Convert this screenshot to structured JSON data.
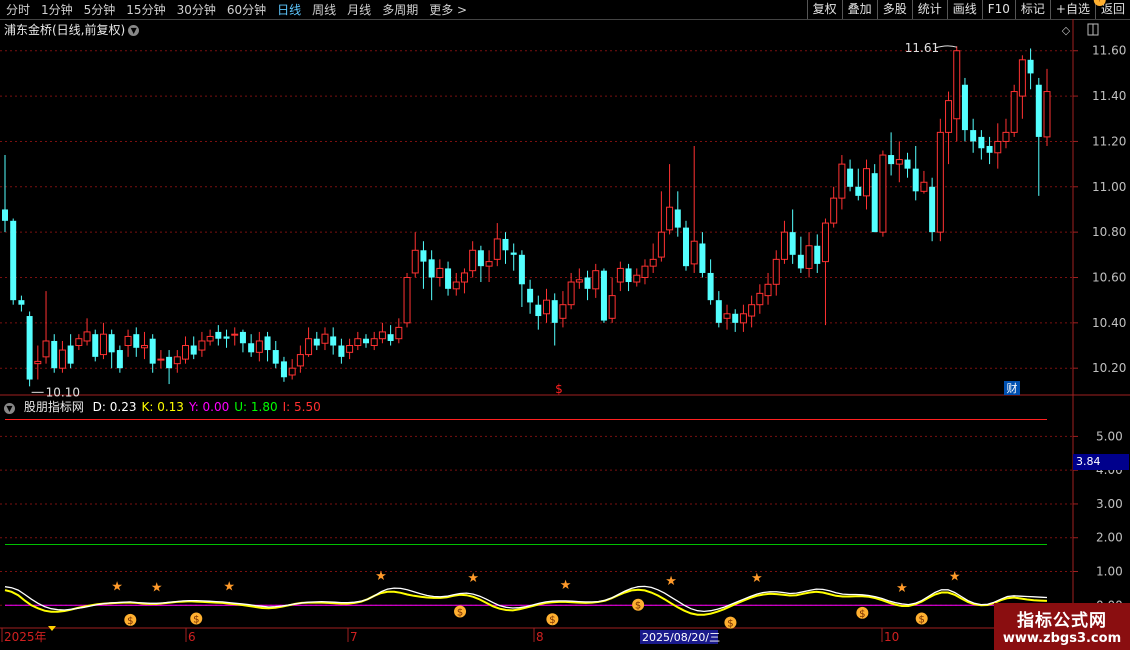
{
  "toolbar": {
    "periods": [
      "分时",
      "1分钟",
      "5分钟",
      "15分钟",
      "30分钟",
      "60分钟",
      "日线",
      "周线",
      "月线",
      "多周期",
      "更多 >"
    ],
    "active_period": "日线",
    "actions": [
      "复权",
      "叠加",
      "多股",
      "统计",
      "画线",
      "F10",
      "标记",
      "+自选",
      "返回"
    ]
  },
  "stock": {
    "title": "浦东金桥(日线,前复权)",
    "high_label": "11.61",
    "low_label": "10.10",
    "marker_s": "$",
    "marker_cai": "财"
  },
  "price_axis": [
    "11.60",
    "11.40",
    "11.20",
    "11.00",
    "10.80",
    "10.60",
    "10.40",
    "10.20"
  ],
  "indicator": {
    "name": "股朋指标网",
    "values": [
      {
        "label": "D: 0.23",
        "color": "#ffffff"
      },
      {
        "label": "K: 0.13",
        "color": "#ffff00"
      },
      {
        "label": "Y: 0.00",
        "color": "#ff00ff"
      },
      {
        "label": "U: 1.80",
        "color": "#00ff00"
      },
      {
        "label": "I: 5.50",
        "color": "#ff3030"
      }
    ],
    "axis": [
      "5.00",
      "4.00",
      "3.00",
      "2.00",
      "1.00",
      "0.00"
    ],
    "current_value": "3.84"
  },
  "time_axis": [
    "2025年",
    "6",
    "7",
    "8",
    "10"
  ],
  "cursor_date": "2025/08/20/三",
  "watermark": {
    "line1": "指标公式网",
    "line2": "www.zbgs3.com"
  },
  "colors": {
    "up": "#ff3232",
    "down": "#54ffff",
    "grid": "#7a1010"
  },
  "chart_data": {
    "type": "candlestick",
    "ylim": [
      10.1,
      11.61
    ],
    "candles": [
      [
        10.9,
        10.85,
        11.14,
        10.8
      ],
      [
        10.85,
        10.5,
        10.86,
        10.48
      ],
      [
        10.5,
        10.48,
        10.52,
        10.45
      ],
      [
        10.43,
        10.15,
        10.45,
        10.12
      ],
      [
        10.22,
        10.23,
        10.3,
        10.15
      ],
      [
        10.25,
        10.32,
        10.54,
        10.22
      ],
      [
        10.32,
        10.2,
        10.35,
        10.18
      ],
      [
        10.2,
        10.28,
        10.32,
        10.18
      ],
      [
        10.3,
        10.22,
        10.35,
        10.2
      ],
      [
        10.3,
        10.33,
        10.35,
        10.28
      ],
      [
        10.32,
        10.36,
        10.42,
        10.3
      ],
      [
        10.35,
        10.25,
        10.37,
        10.23
      ],
      [
        10.26,
        10.35,
        10.4,
        10.24
      ],
      [
        10.35,
        10.27,
        10.37,
        10.2
      ],
      [
        10.28,
        10.2,
        10.3,
        10.18
      ],
      [
        10.3,
        10.34,
        10.37,
        10.25
      ],
      [
        10.35,
        10.29,
        10.38,
        10.25
      ],
      [
        10.29,
        10.3,
        10.36,
        10.24
      ],
      [
        10.33,
        10.22,
        10.35,
        10.18
      ],
      [
        10.24,
        10.24,
        10.28,
        10.2
      ],
      [
        10.25,
        10.2,
        10.28,
        10.13
      ],
      [
        10.22,
        10.25,
        10.28,
        10.18
      ],
      [
        10.24,
        10.3,
        10.34,
        10.22
      ],
      [
        10.3,
        10.26,
        10.34,
        10.24
      ],
      [
        10.28,
        10.32,
        10.36,
        10.25
      ],
      [
        10.32,
        10.34,
        10.37,
        10.3
      ],
      [
        10.36,
        10.33,
        10.39,
        10.3
      ],
      [
        10.34,
        10.33,
        10.37,
        10.29
      ],
      [
        10.35,
        10.35,
        10.38,
        10.3
      ],
      [
        10.36,
        10.31,
        10.37,
        10.27
      ],
      [
        10.31,
        10.27,
        10.35,
        10.25
      ],
      [
        10.27,
        10.32,
        10.36,
        10.23
      ],
      [
        10.34,
        10.28,
        10.36,
        10.23
      ],
      [
        10.28,
        10.22,
        10.32,
        10.2
      ],
      [
        10.23,
        10.16,
        10.25,
        10.14
      ],
      [
        10.17,
        10.2,
        10.24,
        10.15
      ],
      [
        10.21,
        10.26,
        10.3,
        10.18
      ],
      [
        10.26,
        10.33,
        10.38,
        10.25
      ],
      [
        10.33,
        10.3,
        10.36,
        10.28
      ],
      [
        10.31,
        10.35,
        10.38,
        10.28
      ],
      [
        10.34,
        10.3,
        10.38,
        10.26
      ],
      [
        10.3,
        10.25,
        10.33,
        10.22
      ],
      [
        10.27,
        10.3,
        10.33,
        10.24
      ],
      [
        10.3,
        10.33,
        10.36,
        10.28
      ],
      [
        10.33,
        10.31,
        10.35,
        10.29
      ],
      [
        10.3,
        10.33,
        10.36,
        10.28
      ],
      [
        10.33,
        10.36,
        10.4,
        10.31
      ],
      [
        10.35,
        10.32,
        10.39,
        10.3
      ],
      [
        10.33,
        10.38,
        10.42,
        10.31
      ],
      [
        10.4,
        10.6,
        10.62,
        10.38
      ],
      [
        10.62,
        10.72,
        10.8,
        10.6
      ],
      [
        10.72,
        10.67,
        10.76,
        10.55
      ],
      [
        10.68,
        10.6,
        10.72,
        10.5
      ],
      [
        10.6,
        10.64,
        10.68,
        10.56
      ],
      [
        10.64,
        10.55,
        10.67,
        10.52
      ],
      [
        10.55,
        10.58,
        10.62,
        10.52
      ],
      [
        10.58,
        10.62,
        10.64,
        10.53
      ],
      [
        10.63,
        10.72,
        10.76,
        10.6
      ],
      [
        10.72,
        10.65,
        10.74,
        10.58
      ],
      [
        10.65,
        10.67,
        10.72,
        10.58
      ],
      [
        10.68,
        10.77,
        10.84,
        10.65
      ],
      [
        10.77,
        10.72,
        10.8,
        10.66
      ],
      [
        10.71,
        10.7,
        10.75,
        10.63
      ],
      [
        10.7,
        10.57,
        10.72,
        10.47
      ],
      [
        10.55,
        10.49,
        10.59,
        10.44
      ],
      [
        10.48,
        10.43,
        10.52,
        10.37
      ],
      [
        10.44,
        10.5,
        10.55,
        10.4
      ],
      [
        10.5,
        10.4,
        10.53,
        10.3
      ],
      [
        10.42,
        10.48,
        10.54,
        10.38
      ],
      [
        10.48,
        10.58,
        10.62,
        10.46
      ],
      [
        10.58,
        10.59,
        10.64,
        10.55
      ],
      [
        10.6,
        10.55,
        10.63,
        10.5
      ],
      [
        10.55,
        10.63,
        10.66,
        10.51
      ],
      [
        10.63,
        10.41,
        10.64,
        10.4
      ],
      [
        10.42,
        10.52,
        10.6,
        10.4
      ],
      [
        10.58,
        10.64,
        10.67,
        10.54
      ],
      [
        10.64,
        10.58,
        10.66,
        10.54
      ],
      [
        10.58,
        10.61,
        10.64,
        10.56
      ],
      [
        10.6,
        10.65,
        10.68,
        10.57
      ],
      [
        10.65,
        10.68,
        10.75,
        10.62
      ],
      [
        10.69,
        10.8,
        10.98,
        10.67
      ],
      [
        10.81,
        10.91,
        11.1,
        10.79
      ],
      [
        10.9,
        10.82,
        10.98,
        10.78
      ],
      [
        10.82,
        10.65,
        10.85,
        10.63
      ],
      [
        10.66,
        10.76,
        11.18,
        10.62
      ],
      [
        10.75,
        10.62,
        10.8,
        10.6
      ],
      [
        10.62,
        10.5,
        10.68,
        10.48
      ],
      [
        10.5,
        10.4,
        10.54,
        10.38
      ],
      [
        10.42,
        10.44,
        10.48,
        10.37
      ],
      [
        10.44,
        10.4,
        10.46,
        10.36
      ],
      [
        10.4,
        10.44,
        10.48,
        10.36
      ],
      [
        10.43,
        10.48,
        10.52,
        10.38
      ],
      [
        10.48,
        10.53,
        10.57,
        10.44
      ],
      [
        10.52,
        10.57,
        10.62,
        10.48
      ],
      [
        10.57,
        10.68,
        10.72,
        10.52
      ],
      [
        10.68,
        10.8,
        10.85,
        10.66
      ],
      [
        10.8,
        10.7,
        10.9,
        10.66
      ],
      [
        10.7,
        10.64,
        10.78,
        10.62
      ],
      [
        10.64,
        10.74,
        10.8,
        10.6
      ],
      [
        10.74,
        10.66,
        10.79,
        10.62
      ],
      [
        10.67,
        10.84,
        10.86,
        10.39
      ],
      [
        10.84,
        10.95,
        11.0,
        10.82
      ],
      [
        10.95,
        11.1,
        11.14,
        10.9
      ],
      [
        11.08,
        11.0,
        11.12,
        10.98
      ],
      [
        11.0,
        10.96,
        11.08,
        10.94
      ],
      [
        10.96,
        11.08,
        11.12,
        10.9
      ],
      [
        11.06,
        10.8,
        11.1,
        10.8
      ],
      [
        10.8,
        11.14,
        11.16,
        10.78
      ],
      [
        11.14,
        11.1,
        11.24,
        11.05
      ],
      [
        11.1,
        11.12,
        11.2,
        11.02
      ],
      [
        11.12,
        11.08,
        11.15,
        11.04
      ],
      [
        11.08,
        10.98,
        11.18,
        10.94
      ],
      [
        10.98,
        11.02,
        11.07,
        10.97
      ],
      [
        11.0,
        10.8,
        11.04,
        10.76
      ],
      [
        10.8,
        11.24,
        11.3,
        10.76
      ],
      [
        11.24,
        11.38,
        11.42,
        11.1
      ],
      [
        11.3,
        11.6,
        11.62,
        11.2
      ],
      [
        11.45,
        11.25,
        11.48,
        11.2
      ],
      [
        11.25,
        11.2,
        11.3,
        11.15
      ],
      [
        11.22,
        11.17,
        11.25,
        11.12
      ],
      [
        11.18,
        11.15,
        11.22,
        11.1
      ],
      [
        11.15,
        11.2,
        11.28,
        11.08
      ],
      [
        11.2,
        11.24,
        11.3,
        11.17
      ],
      [
        11.24,
        11.42,
        11.45,
        11.22
      ],
      [
        11.4,
        11.56,
        11.58,
        11.3
      ],
      [
        11.56,
        11.5,
        11.61,
        11.43
      ],
      [
        11.45,
        11.22,
        11.48,
        10.96
      ],
      [
        11.22,
        11.42,
        11.52,
        11.18
      ]
    ],
    "indicator_d": [
      0.55,
      0.52,
      0.45,
      0.32,
      0.18,
      0.06,
      -0.04,
      -0.1,
      -0.13,
      -0.14,
      -0.12,
      -0.09,
      -0.06,
      -0.02,
      0.02,
      0.05,
      0.07,
      0.08,
      0.09,
      0.1,
      0.08,
      0.07,
      0.06,
      0.06,
      0.07,
      0.09,
      0.11,
      0.13,
      0.14,
      0.14,
      0.13,
      0.12,
      0.11,
      0.1,
      0.08,
      0.06,
      0.04,
      0.02,
      -0.01,
      -0.03,
      -0.05,
      -0.04,
      -0.02,
      0.01,
      0.04,
      0.07,
      0.09,
      0.1,
      0.11,
      0.1,
      0.09,
      0.08,
      0.08,
      0.09,
      0.12,
      0.18,
      0.28,
      0.4,
      0.48,
      0.51,
      0.5,
      0.46,
      0.4,
      0.34,
      0.29,
      0.26,
      0.25,
      0.27,
      0.31,
      0.35,
      0.36,
      0.33,
      0.27,
      0.18,
      0.08,
      -0.01,
      -0.06,
      -0.08,
      -0.07,
      -0.04,
      0.01,
      0.06,
      0.1,
      0.12,
      0.13,
      0.13,
      0.12,
      0.11,
      0.1,
      0.1,
      0.11,
      0.15,
      0.22,
      0.32,
      0.42,
      0.5,
      0.55,
      0.56,
      0.53,
      0.46,
      0.36,
      0.24,
      0.12,
      0.0,
      -0.1,
      -0.16,
      -0.18,
      -0.16,
      -0.12,
      -0.06,
      0.02,
      0.1,
      0.18,
      0.26,
      0.33,
      0.38,
      0.4,
      0.4,
      0.38,
      0.35,
      0.36,
      0.4,
      0.44,
      0.48,
      0.47,
      0.43,
      0.37,
      0.33,
      0.32,
      0.32,
      0.31,
      0.29,
      0.25,
      0.2,
      0.13,
      0.08,
      0.04,
      0.02,
      0.06,
      0.14,
      0.26,
      0.38,
      0.46,
      0.46,
      0.38,
      0.26,
      0.14,
      0.06,
      0.02,
      0.03,
      0.09,
      0.18,
      0.26,
      0.28,
      0.27,
      0.26,
      0.25,
      0.24,
      0.23
    ],
    "indicator_k": [
      0.45,
      0.4,
      0.3,
      0.14,
      0.0,
      -0.09,
      -0.16,
      -0.19,
      -0.19,
      -0.17,
      -0.13,
      -0.08,
      -0.04,
      0.0,
      0.03,
      0.05,
      0.06,
      0.07,
      0.08,
      0.08,
      0.07,
      0.05,
      0.04,
      0.04,
      0.06,
      0.08,
      0.1,
      0.11,
      0.12,
      0.11,
      0.1,
      0.09,
      0.08,
      0.07,
      0.05,
      0.03,
      0.01,
      -0.02,
      -0.05,
      -0.08,
      -0.09,
      -0.07,
      -0.04,
      0.0,
      0.04,
      0.07,
      0.08,
      0.08,
      0.08,
      0.07,
      0.06,
      0.05,
      0.05,
      0.07,
      0.11,
      0.18,
      0.28,
      0.36,
      0.4,
      0.4,
      0.37,
      0.32,
      0.28,
      0.25,
      0.23,
      0.22,
      0.22,
      0.24,
      0.28,
      0.31,
      0.3,
      0.25,
      0.17,
      0.07,
      -0.03,
      -0.1,
      -0.14,
      -0.15,
      -0.12,
      -0.07,
      -0.02,
      0.03,
      0.07,
      0.09,
      0.1,
      0.1,
      0.09,
      0.08,
      0.07,
      0.08,
      0.1,
      0.14,
      0.21,
      0.3,
      0.38,
      0.44,
      0.46,
      0.44,
      0.38,
      0.29,
      0.18,
      0.06,
      -0.06,
      -0.16,
      -0.24,
      -0.28,
      -0.28,
      -0.25,
      -0.19,
      -0.12,
      -0.03,
      0.06,
      0.14,
      0.22,
      0.28,
      0.32,
      0.34,
      0.33,
      0.31,
      0.29,
      0.3,
      0.34,
      0.38,
      0.4,
      0.38,
      0.33,
      0.28,
      0.26,
      0.26,
      0.27,
      0.27,
      0.25,
      0.21,
      0.15,
      0.08,
      0.02,
      -0.02,
      -0.02,
      0.03,
      0.11,
      0.22,
      0.32,
      0.38,
      0.38,
      0.31,
      0.2,
      0.1,
      0.03,
      0.0,
      0.01,
      0.07,
      0.15,
      0.21,
      0.23,
      0.2,
      0.17,
      0.15,
      0.14,
      0.13
    ],
    "icons_up": [
      17,
      23,
      34,
      57,
      71,
      85,
      101,
      114,
      136,
      144,
      172
    ],
    "icons_down": [
      19,
      29,
      69,
      83,
      96,
      110,
      130,
      139,
      156,
      166
    ]
  }
}
